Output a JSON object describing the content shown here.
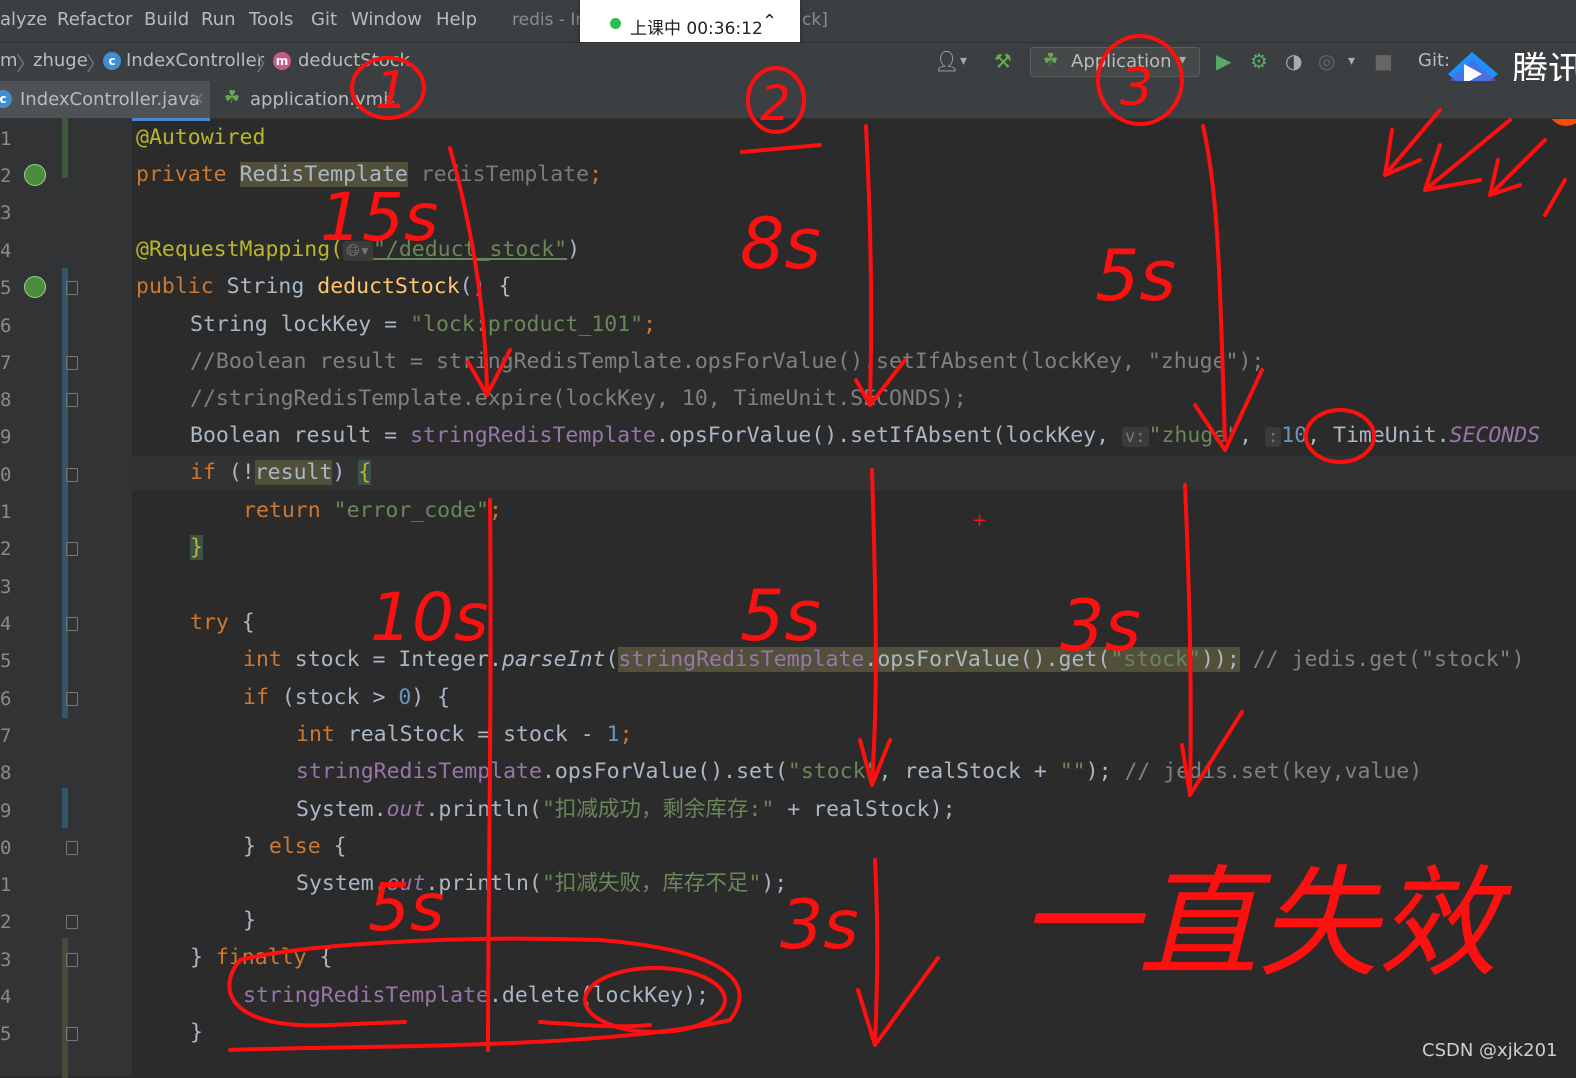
{
  "menubar": {
    "items": [
      "alyze",
      "Refactor",
      "Build",
      "Run",
      "Tools",
      "Git",
      "Window",
      "Help"
    ],
    "window_title_left": "redis - In",
    "window_title_right": "ck]"
  },
  "class_popup": {
    "text": "上课中 00:36:12",
    "status_color": "#27c04f"
  },
  "navbar": {
    "crumbs": [
      "m",
      "zhuge",
      "IndexController",
      "deductStock"
    ],
    "run_config": "Application",
    "git_label": "Git:"
  },
  "logo": {
    "text": "腾讯"
  },
  "tabs": [
    {
      "label": "IndexController.java",
      "active": true
    },
    {
      "label": "application.yml",
      "active": false
    }
  ],
  "gutter": {
    "line_numbers": [
      "1",
      "2",
      "3",
      "4",
      "5",
      "6",
      "7",
      "8",
      "9",
      "0",
      "1",
      "2",
      "3",
      "4",
      "5",
      "6",
      "7",
      "8",
      "9",
      "0",
      "1",
      "2",
      "3",
      "4",
      "5"
    ]
  },
  "code": {
    "l1_ann": "@Autowired",
    "l2_kw": "private",
    "l2_type": "RedisTemplate",
    "l2_field": "redisTemplate",
    "l2_end": ";",
    "l4_ann": "@RequestMapping(",
    "l4_str": "\"/deduct_stock\"",
    "l4_end": ")",
    "l5_kw": "public",
    "l5_type": "String",
    "l5_meth": "deductStock",
    "l5_rest": "() {",
    "l6_a": "String lockKey = ",
    "l6_str": "\"lock:product_101\"",
    "l6_end": ";",
    "l7_cmt": "//Boolean result = stringRedisTemplate.opsForValue().setIfAbsent(lockKey, \"zhuge\");",
    "l8_cmt": "//stringRedisTemplate.expire(lockKey, 10, TimeUnit.SECONDS);",
    "l9_a": "Boolean result = ",
    "l9_fld": "stringRedisTemplate",
    "l9_b": ".opsForValue().setIfAbsent(lockKey, ",
    "l9_hint_v": "v:",
    "l9_str": "\"zhuge\"",
    "l9_c": ", ",
    "l9_hint_t": ":",
    "l9_num": "10",
    "l9_d": ", TimeUnit.",
    "l9_const": "SECONDS",
    "l10_kw": "if",
    "l10_a": " (!",
    "l10_hl": "result",
    "l10_b": ") ",
    "l10_brace": "{",
    "l11_kw": "return",
    "l11_str": "\"error_code\"",
    "l11_end": ";",
    "l12_brace": "}",
    "l14_kw": "try",
    "l14_b": " {",
    "l15_kw": "int",
    "l15_a": " stock = Integer.",
    "l15_meth": "parseInt",
    "l15_b": "(",
    "l15_hl": "stringRedisTemplate",
    "l15_c": ".opsForValue().get(",
    "l15_str": "\"stock\"",
    "l15_d": "));",
    "l15_cmt": " // jedis.get(\"stock\")",
    "l16_kw": "if",
    "l16_a": " (stock > ",
    "l16_num": "0",
    "l16_b": ") {",
    "l17_kw": "int",
    "l17_a": " realStock = stock - ",
    "l17_num": "1",
    "l17_end": ";",
    "l18_fld": "stringRedisTemplate",
    "l18_a": ".opsForValue().set(",
    "l18_str": "\"stock\"",
    "l18_b": ", realStock + ",
    "l18_str2": "\"\"",
    "l18_c": ");",
    "l18_cmt": " // jedis.set(key,value)",
    "l19_a": "System.",
    "l19_out": "out",
    "l19_b": ".println(",
    "l19_str": "\"扣减成功，剩余库存:\"",
    "l19_c": " + realStock);",
    "l20_a": "} ",
    "l20_kw": "else",
    "l20_b": " {",
    "l21_a": "System.",
    "l21_out": "out",
    "l21_b": ".println(",
    "l21_str": "\"扣减失败，库存不足\"",
    "l21_c": ");",
    "l22_a": "}",
    "l23_a": "} ",
    "l23_kw": "finally",
    "l23_b": " {",
    "l24_fld": "stringRedisTemplate",
    "l24_a": ".delete(lockKey);",
    "l25_a": "}"
  },
  "annotations": {
    "circle_1": "1",
    "circle_2": "2",
    "circle_3": "3",
    "t_15s": "15s",
    "t_8s": "8s",
    "t_5s_a": "5s",
    "t_10s": "10s",
    "t_5s_b": "5s",
    "t_3s_a": "3s",
    "t_5s_c": "5s",
    "t_3s_b": "3s",
    "note": "一直失效",
    "ink_color": "#ff1010"
  },
  "watermark": "CSDN @xjk201"
}
